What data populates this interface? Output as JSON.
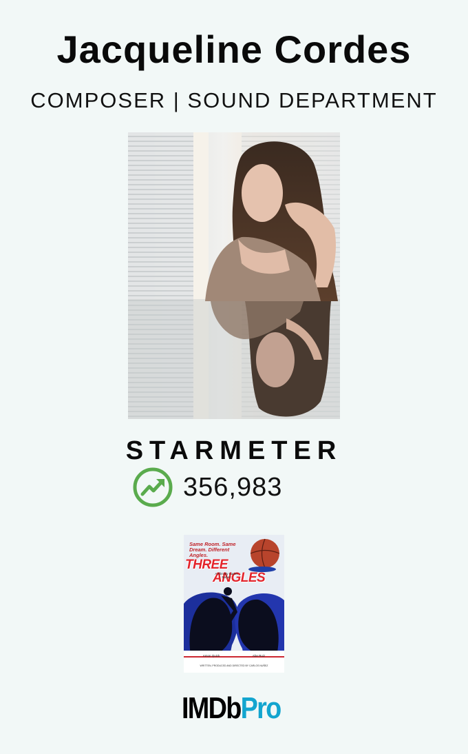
{
  "profile": {
    "name": "Jacqueline Cordes",
    "roles": "COMPOSER | SOUND DEPARTMENT"
  },
  "starmeter": {
    "label": "STARMETER",
    "rank": "356,983",
    "trend": "up",
    "icon": "trending-up-icon",
    "icon_color": "#5aab4d"
  },
  "known_for": {
    "poster": {
      "tagline": "Same Room. Same Dream. Different Angles.",
      "title_line1": "THREE",
      "title_line2": "ANGLES",
      "credit": "A Film By Carlos Nuñez",
      "cast": [
        "Amon Quick",
        "Abe Ruiz"
      ],
      "billing": "WRITTEN, PRODUCED AND DIRECTED BY CARLOS NUÑEZ"
    }
  },
  "brand": {
    "logo_part1": "IMDb",
    "logo_part2": "Pro",
    "accent_color": "#13a5cf"
  }
}
